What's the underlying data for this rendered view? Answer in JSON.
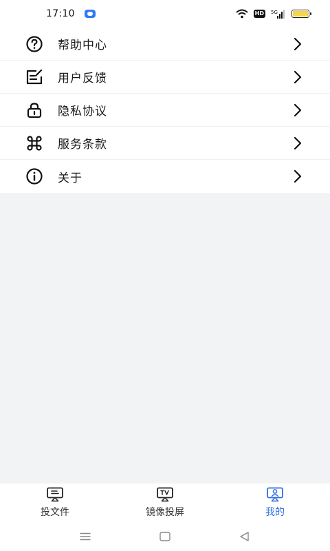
{
  "status_bar": {
    "time": "17:10",
    "hd_label": "HD",
    "network_label": "5G",
    "battery_color": "#f6d54a",
    "app_indicator_color": "#2f7bf4"
  },
  "menu": {
    "items": [
      {
        "label": "帮助中心",
        "icon": "help-circle-icon"
      },
      {
        "label": "用户反馈",
        "icon": "feedback-edit-icon"
      },
      {
        "label": "隐私协议",
        "icon": "lock-icon"
      },
      {
        "label": "服务条款",
        "icon": "command-icon"
      },
      {
        "label": "关于",
        "icon": "info-icon"
      }
    ]
  },
  "tab_bar": {
    "tabs": [
      {
        "label": "投文件",
        "icon": "cast-file-icon",
        "active": false
      },
      {
        "label": "镜像投屏",
        "icon": "tv-mirror-icon",
        "active": false
      },
      {
        "label": "我的",
        "icon": "profile-cast-icon",
        "active": true
      }
    ],
    "active_color": "#2f6fe0"
  },
  "background_color": "#f2f3f5"
}
